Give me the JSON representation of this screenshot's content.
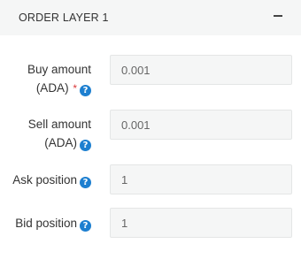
{
  "panel": {
    "title": "ORDER LAYER 1",
    "collapse_icon": "minus-icon"
  },
  "fields": [
    {
      "label_line1": "Buy amount",
      "label_line2": "(ADA)",
      "required": true,
      "required_mark": "*",
      "value": "0.001",
      "help_icon": "question-circle-icon"
    },
    {
      "label_line1": "Sell amount",
      "label_line2": "(ADA)",
      "required": false,
      "value": "0.001",
      "help_icon": "question-circle-icon"
    },
    {
      "label": "Ask position",
      "value": "1",
      "help_icon": "question-circle-icon"
    },
    {
      "label": "Bid position",
      "value": "1",
      "help_icon": "question-circle-icon"
    }
  ],
  "help_glyph": "?",
  "colors": {
    "header_bg": "#f5f6f6",
    "input_bg": "#f5f6f6",
    "help_icon": "#1d7fd0",
    "required": "#d9383a"
  }
}
